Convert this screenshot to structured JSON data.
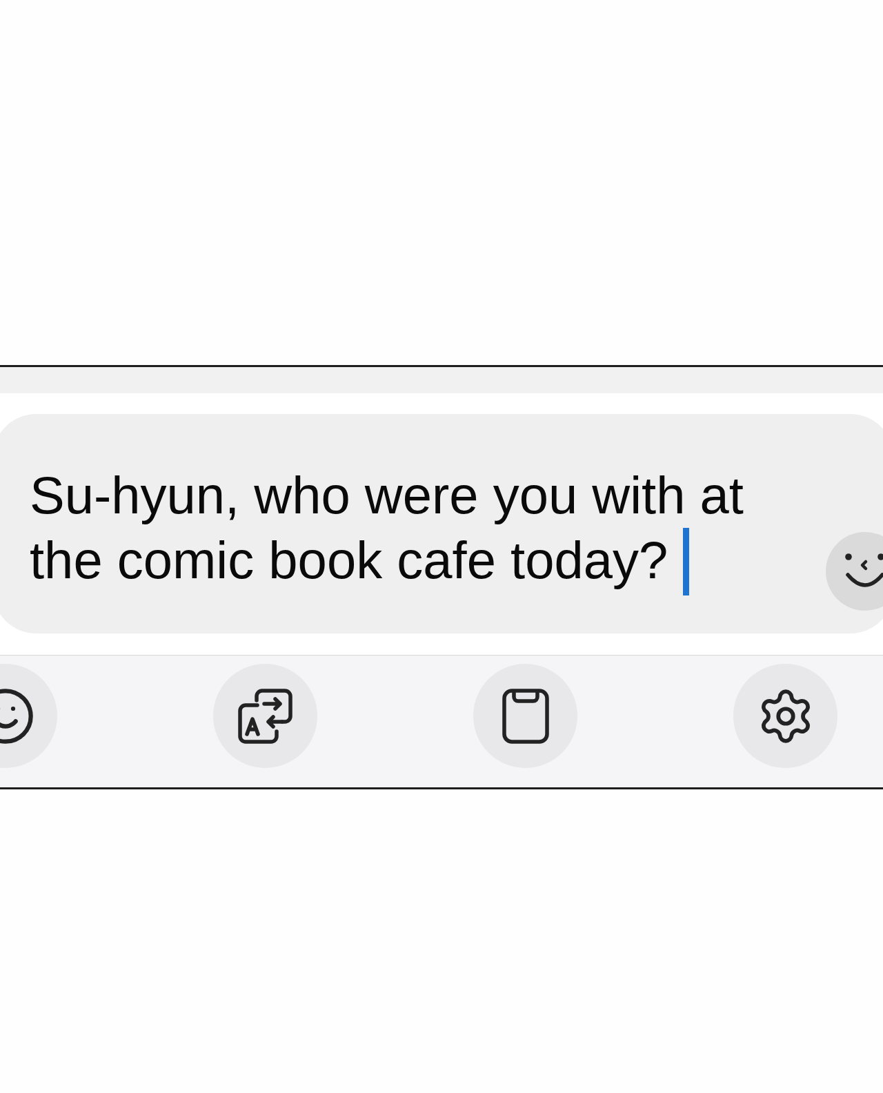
{
  "message_input": {
    "value": "Su-hyun, who were you with at the comic book cafe today?",
    "focused": true,
    "trailing_button": {
      "kind": "emoji"
    }
  },
  "toolbar": {
    "buttons": [
      {
        "kind": "emoji"
      },
      {
        "kind": "translate"
      },
      {
        "kind": "clipboard"
      },
      {
        "kind": "settings"
      }
    ]
  }
}
